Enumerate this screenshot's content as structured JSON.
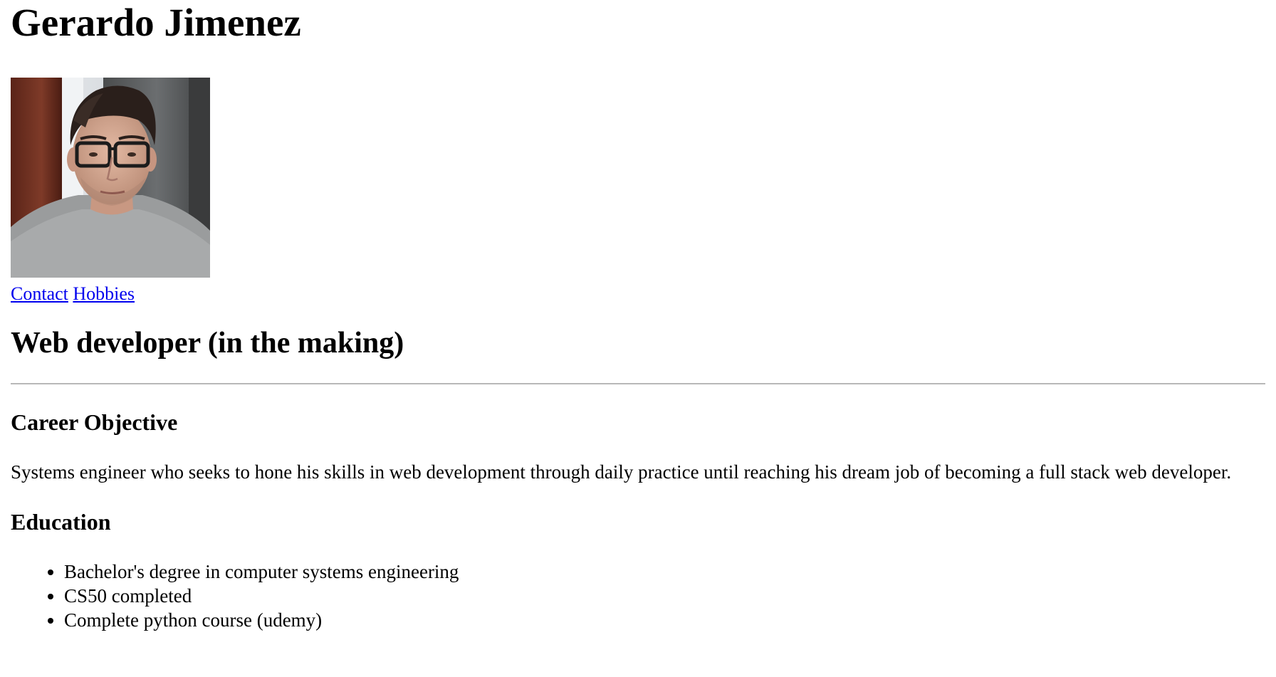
{
  "header": {
    "name": "Gerardo Jimenez"
  },
  "photo": {
    "alt": "Gerardo Jimenez"
  },
  "nav": {
    "items": [
      {
        "label": "Contact"
      },
      {
        "label": "Hobbies"
      }
    ]
  },
  "headline": "Web developer (in the making)",
  "career": {
    "title": "Career Objective",
    "text": "Systems engineer who seeks to hone his skills in web development through daily practice until reaching his dream job of becoming a full stack web developer."
  },
  "education": {
    "title": "Education",
    "items": [
      "Bachelor's degree in computer systems engineering",
      "CS50 completed",
      "Complete python course (udemy)"
    ]
  },
  "colors": {
    "link": "#0000ee",
    "rule": "#b8b8b8"
  }
}
